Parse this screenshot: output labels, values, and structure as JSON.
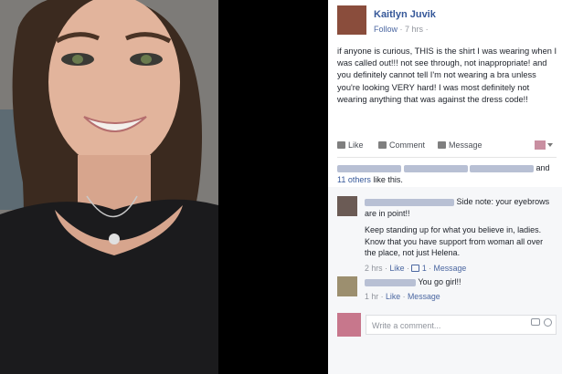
{
  "post": {
    "author": "Kaitlyn Juvik",
    "follow_label": "Follow",
    "time": "7 hrs",
    "text": "if anyone is curious, THIS is the shirt I was wearing when I was called out!!! not see through, not inappropriate! and you definitely cannot tell I'm not wearing a bra unless you're looking VERY hard! I was most definitely not wearing anything that was against the dress code!!"
  },
  "actions": {
    "like_label": "Like",
    "comment_label": "Comment",
    "message_label": "Message"
  },
  "likes": {
    "and_text": "and",
    "others_label": "11 others",
    "like_this_text": "like this."
  },
  "comments": [
    {
      "text": "Side note: your eyebrows are in point!!",
      "reply": "Keep standing up for what you believe in, ladies. Know that you have support from woman all over the place, not just Helena.",
      "time": "2 hrs",
      "like_label": "Like",
      "like_count": "1",
      "message_label": "Message"
    },
    {
      "text": "You go girl!!",
      "time": "1 hr",
      "like_label": "Like",
      "message_label": "Message"
    }
  ],
  "composer": {
    "placeholder": "Write a comment..."
  },
  "icons": {
    "like": "thumbs-up-icon",
    "comment": "speech-bubble-icon",
    "message": "message-icon",
    "camera": "camera-icon",
    "emoji": "smiley-icon"
  },
  "colors": {
    "link": "#365899",
    "meta": "#90949c",
    "comments_bg": "#f6f7f9"
  }
}
